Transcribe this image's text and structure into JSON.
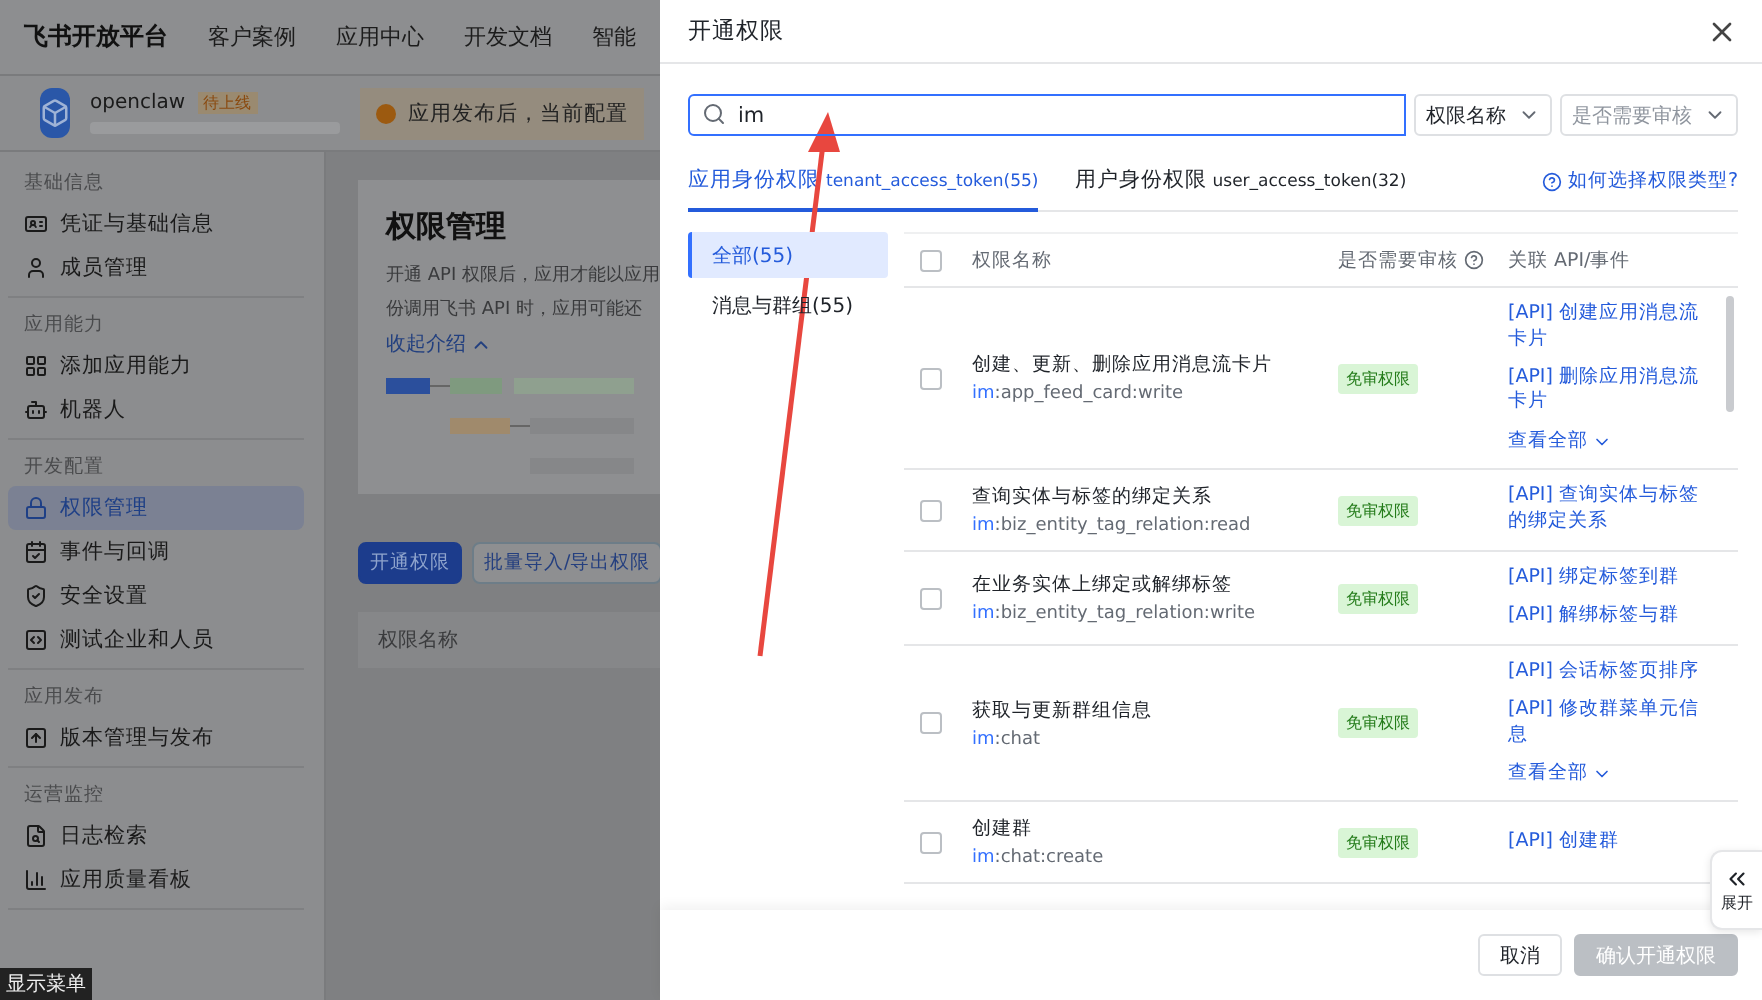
{
  "topnav": {
    "brand": "飞书开放平台",
    "links": [
      "客户案例",
      "应用中心",
      "开发文档",
      "智能"
    ]
  },
  "appbar": {
    "app_name": "openclaw",
    "status": "待上线",
    "notice": "应用发布后，当前配置"
  },
  "sidebar": {
    "groups": [
      {
        "label": "基础信息",
        "items": [
          {
            "label": "凭证与基础信息",
            "selected": false
          },
          {
            "label": "成员管理",
            "selected": false
          }
        ]
      },
      {
        "label": "应用能力",
        "items": [
          {
            "label": "添加应用能力",
            "selected": false
          },
          {
            "label": "机器人",
            "selected": false
          }
        ]
      },
      {
        "label": "开发配置",
        "items": [
          {
            "label": "权限管理",
            "selected": true
          },
          {
            "label": "事件与回调",
            "selected": false
          },
          {
            "label": "安全设置",
            "selected": false
          },
          {
            "label": "测试企业和人员",
            "selected": false
          }
        ]
      },
      {
        "label": "应用发布",
        "items": [
          {
            "label": "版本管理与发布",
            "selected": false
          }
        ]
      },
      {
        "label": "运营监控",
        "items": [
          {
            "label": "日志检索",
            "selected": false
          },
          {
            "label": "应用质量看板",
            "selected": false
          }
        ]
      }
    ],
    "show_menu": "显示菜单"
  },
  "page": {
    "title": "权限管理",
    "description": [
      "开通 API 权限后，应用才能以应用",
      "份调用飞书 API 时，应用可能还"
    ],
    "collapse_link": "收起介绍",
    "buttons": [
      "开通权限",
      "批量导入/导出权限"
    ],
    "table_header": "权限名称"
  },
  "drawer": {
    "title": "开通权限",
    "search": {
      "value": "im"
    },
    "filters": [
      {
        "label": "权限名称",
        "placeholder": false
      },
      {
        "label": "是否需要审核",
        "placeholder": true
      }
    ],
    "tabs": [
      {
        "label": "应用身份权限",
        "token": "tenant_access_token(55)",
        "selected": true
      },
      {
        "label": "用户身份权限",
        "token": "user_access_token(32)",
        "selected": false
      }
    ],
    "help_link": "如何选择权限类型?",
    "categories": [
      {
        "label": "全部(55)",
        "selected": true
      },
      {
        "label": "消息与群组(55)",
        "selected": false
      }
    ],
    "table": {
      "all_checked": false,
      "columns": [
        "权限名称",
        "是否需要审核",
        "关联 API/事件"
      ],
      "rows": [
        {
          "name": "创建、更新、删除应用消息流卡片",
          "scope_prefix": "im",
          "scope": ":app_feed_card:write",
          "review": "免审权限",
          "checked": false,
          "apis": [
            "[API] 创建应用消息流卡片",
            "[API] 删除应用消息流卡片"
          ],
          "more": "查看全部"
        },
        {
          "name": "查询实体与标签的绑定关系",
          "scope_prefix": "im",
          "scope": ":biz_entity_tag_relation:read",
          "review": "免审权限",
          "checked": false,
          "apis": [
            "[API] 查询实体与标签的绑定关系"
          ]
        },
        {
          "name": "在业务实体上绑定或解绑标签",
          "scope_prefix": "im",
          "scope": ":biz_entity_tag_relation:write",
          "review": "免审权限",
          "checked": false,
          "apis": [
            "[API] 绑定标签到群",
            "[API] 解绑标签与群"
          ]
        },
        {
          "name": "获取与更新群组信息",
          "scope_prefix": "im",
          "scope": ":chat",
          "review": "免审权限",
          "checked": false,
          "apis": [
            "[API] 会话标签页排序",
            "[API] 修改群菜单元信息"
          ],
          "more": "查看全部"
        },
        {
          "name": "创建群",
          "scope_prefix": "im",
          "scope": ":chat:create",
          "review": "免审权限",
          "checked": false,
          "apis": [
            "[API] 创建群"
          ]
        }
      ]
    },
    "expand_label": "展开",
    "footer": {
      "cancel": "取消",
      "confirm": "确认开通权限",
      "confirm_disabled": true
    }
  }
}
